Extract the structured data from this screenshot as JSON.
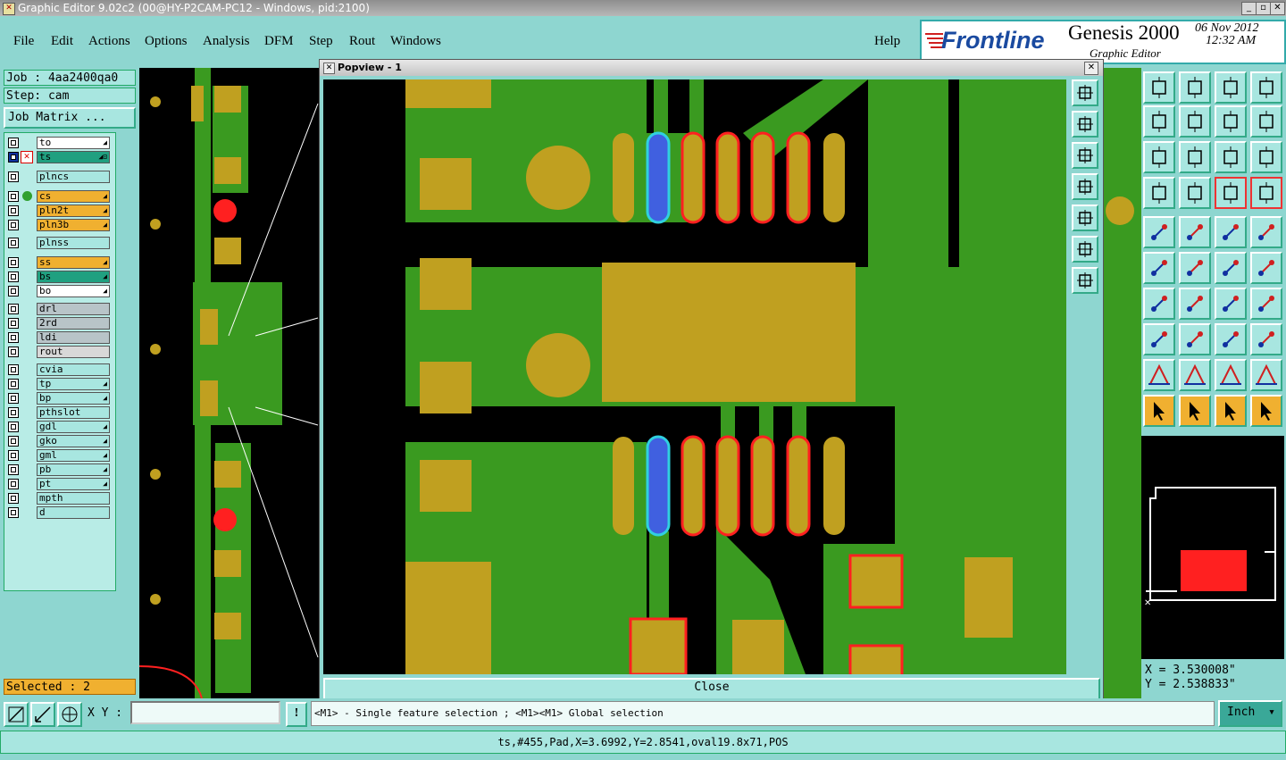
{
  "window": {
    "title": "Graphic Editor 9.02c2 (00@HY-P2CAM-PC12 - Windows, pid:2100)"
  },
  "menu": {
    "items": [
      "File",
      "Edit",
      "Actions",
      "Options",
      "Analysis",
      "DFM",
      "Step",
      "Rout",
      "Windows"
    ],
    "help": "Help"
  },
  "brand": {
    "logo": "Frontline",
    "product": "Genesis 2000",
    "subtitle": "Graphic Editor",
    "date": "06 Nov 2012",
    "time": "12:32 AM"
  },
  "job": {
    "job_label": "Job : 4aa2400qa0",
    "step_label": "Step: cam",
    "matrix_button": "Job Matrix ..."
  },
  "layers": [
    {
      "name": "to",
      "color": "#ffffff",
      "tag": "◢"
    },
    {
      "name": "ts",
      "color": "#20a080",
      "tag": "◢⊡",
      "selected": true
    },
    {
      "name": "plncs",
      "color": "#a8e6e0",
      "tag": ""
    },
    {
      "name": "cs",
      "color": "#f0b030",
      "tag": "◢",
      "active": true
    },
    {
      "name": "pln2t",
      "color": "#f0b030",
      "tag": "◢"
    },
    {
      "name": "pln3b",
      "color": "#f0b030",
      "tag": "◢"
    },
    {
      "name": "plnss",
      "color": "#a8e6e0",
      "tag": ""
    },
    {
      "name": "ss",
      "color": "#f0b030",
      "tag": "◢"
    },
    {
      "name": "bs",
      "color": "#20a080",
      "tag": "◢"
    },
    {
      "name": "bo",
      "color": "#ffffff",
      "tag": "◢"
    },
    {
      "name": "drl",
      "color": "#b8c4c8",
      "tag": ""
    },
    {
      "name": "2rd",
      "color": "#b8c4c8",
      "tag": ""
    },
    {
      "name": "ldi",
      "color": "#b8c4c8",
      "tag": ""
    },
    {
      "name": "rout",
      "color": "#d8d8d8",
      "tag": ""
    },
    {
      "name": "cvia",
      "color": "#a8e6e0",
      "tag": ""
    },
    {
      "name": "tp",
      "color": "#a8e6e0",
      "tag": "◢"
    },
    {
      "name": "bp",
      "color": "#a8e6e0",
      "tag": "◢"
    },
    {
      "name": "pthslot",
      "color": "#a8e6e0",
      "tag": ""
    },
    {
      "name": "gdl",
      "color": "#a8e6e0",
      "tag": "◢"
    },
    {
      "name": "gko",
      "color": "#a8e6e0",
      "tag": "◢"
    },
    {
      "name": "gml",
      "color": "#a8e6e0",
      "tag": "◢"
    },
    {
      "name": "pb",
      "color": "#a8e6e0",
      "tag": "◢"
    },
    {
      "name": "pt",
      "color": "#a8e6e0",
      "tag": "◢"
    },
    {
      "name": "mpth",
      "color": "#a8e6e0",
      "tag": ""
    },
    {
      "name": "d",
      "color": "#a8e6e0",
      "tag": ""
    }
  ],
  "selected_label": "Selected : 2",
  "popup": {
    "title": "Popview - 1",
    "close_label": "Close"
  },
  "coords": {
    "x": "X = 3.530008\"",
    "y": "Y = 2.538833\""
  },
  "input": {
    "xy_label": "X Y :",
    "value": "",
    "units": "Inch"
  },
  "hint": "<M1> - Single feature selection ; <M1><M1> Global selection",
  "status": "ts,#455,Pad,X=3.6992,Y=2.8541,oval19.8x71,POS",
  "colors": {
    "copper": "#c0a020",
    "trace": "#3a9a20",
    "highlight": "#ff2020",
    "selected": "#4060e0",
    "panel": "#8ed6d0"
  }
}
